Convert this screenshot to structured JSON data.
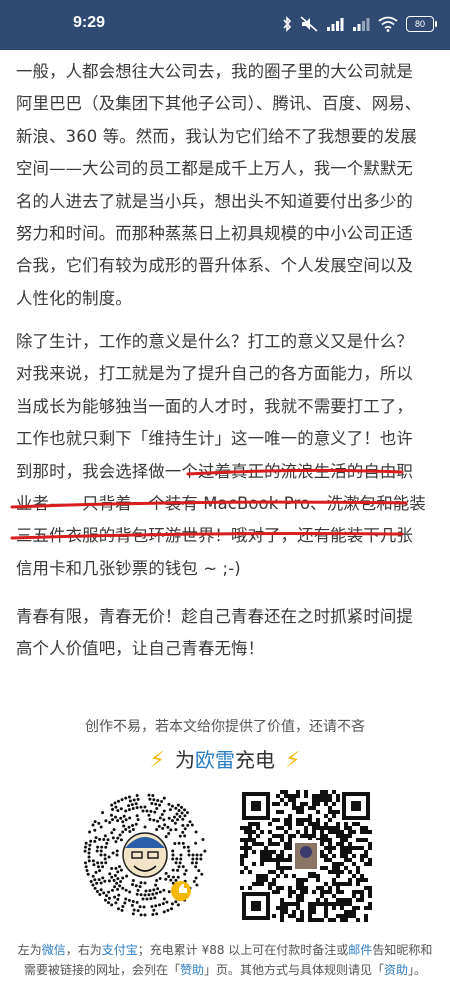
{
  "status_bar": {
    "time": "9:29",
    "battery": "80",
    "icons": [
      "bluetooth-icon",
      "mute-icon",
      "signal-icon",
      "signal-icon",
      "wifi-icon",
      "battery-icon"
    ]
  },
  "article": {
    "paragraph1": "一般，人都会想往大公司去，我的圈子里的大公司就是阿里巴巴（及集团下其他子公司）、腾讯、百度、网易、新浪、360 等。然而，我认为它们给不了我想要的发展空间——大公司的员工都是成千上万人，我一个默默无名的人进去了就是当小兵，想出头不知道要付出多少的努力和时间。而那种蒸蒸日上初具规模的中小公司正适合我，它们有较为成形的晋升体系、个人发展空间以及人性化的制度。",
    "paragraph2_part1": "除了生计，工作的意义是什么？打工的意义又是什么？对我来说，打工就是为了提升自己的各方面能力，所以当成长为能够独当一面的人才时，我就不需要打工了，工作也就只剩下「维持生计」这一唯一的意义了！也许到那时，",
    "paragraph2_highlight": "我会选择做一个过着真正的流浪生活的自由职业者——只背着一个装有 MacBook Pro、洗漱包和能装三五件衣服的背包环游世界！哦对",
    "paragraph2_part2": "了，还有能装下几张信用卡和几张钞票的钱包 ~ ;-)",
    "paragraph3": "青春有限，青春无价！趁自己青春还在之时抓紧时间提高个人价值吧，让自己青春无悔！"
  },
  "reward": {
    "note": "创作不易，若本文给你提供了价值，还请不吝",
    "bolt": "⚡",
    "headline_prefix": "为",
    "brand": "欧雷",
    "headline_suffix": "充电"
  },
  "footer": {
    "t1": "左为",
    "wechat": "微信",
    "t2": "，右为",
    "alipay": "支付宝",
    "t3": "；充电累计 ",
    "amount": "¥88",
    "t4": " 以上可在付款时备注或",
    "mail": "邮件",
    "t5": "告知昵称和需要被链接的网址，会列在「",
    "zanzhu": "赞助",
    "t6": "」页。其他方式与具体规则请见「",
    "zizhu": "资助",
    "t7": "」。"
  },
  "colors": {
    "status_bar_bg": "#2f4a73",
    "text": "#3a3a3a",
    "link": "#2c7ec3",
    "bolt": "#f5b800",
    "underline": "#d81e1e"
  }
}
